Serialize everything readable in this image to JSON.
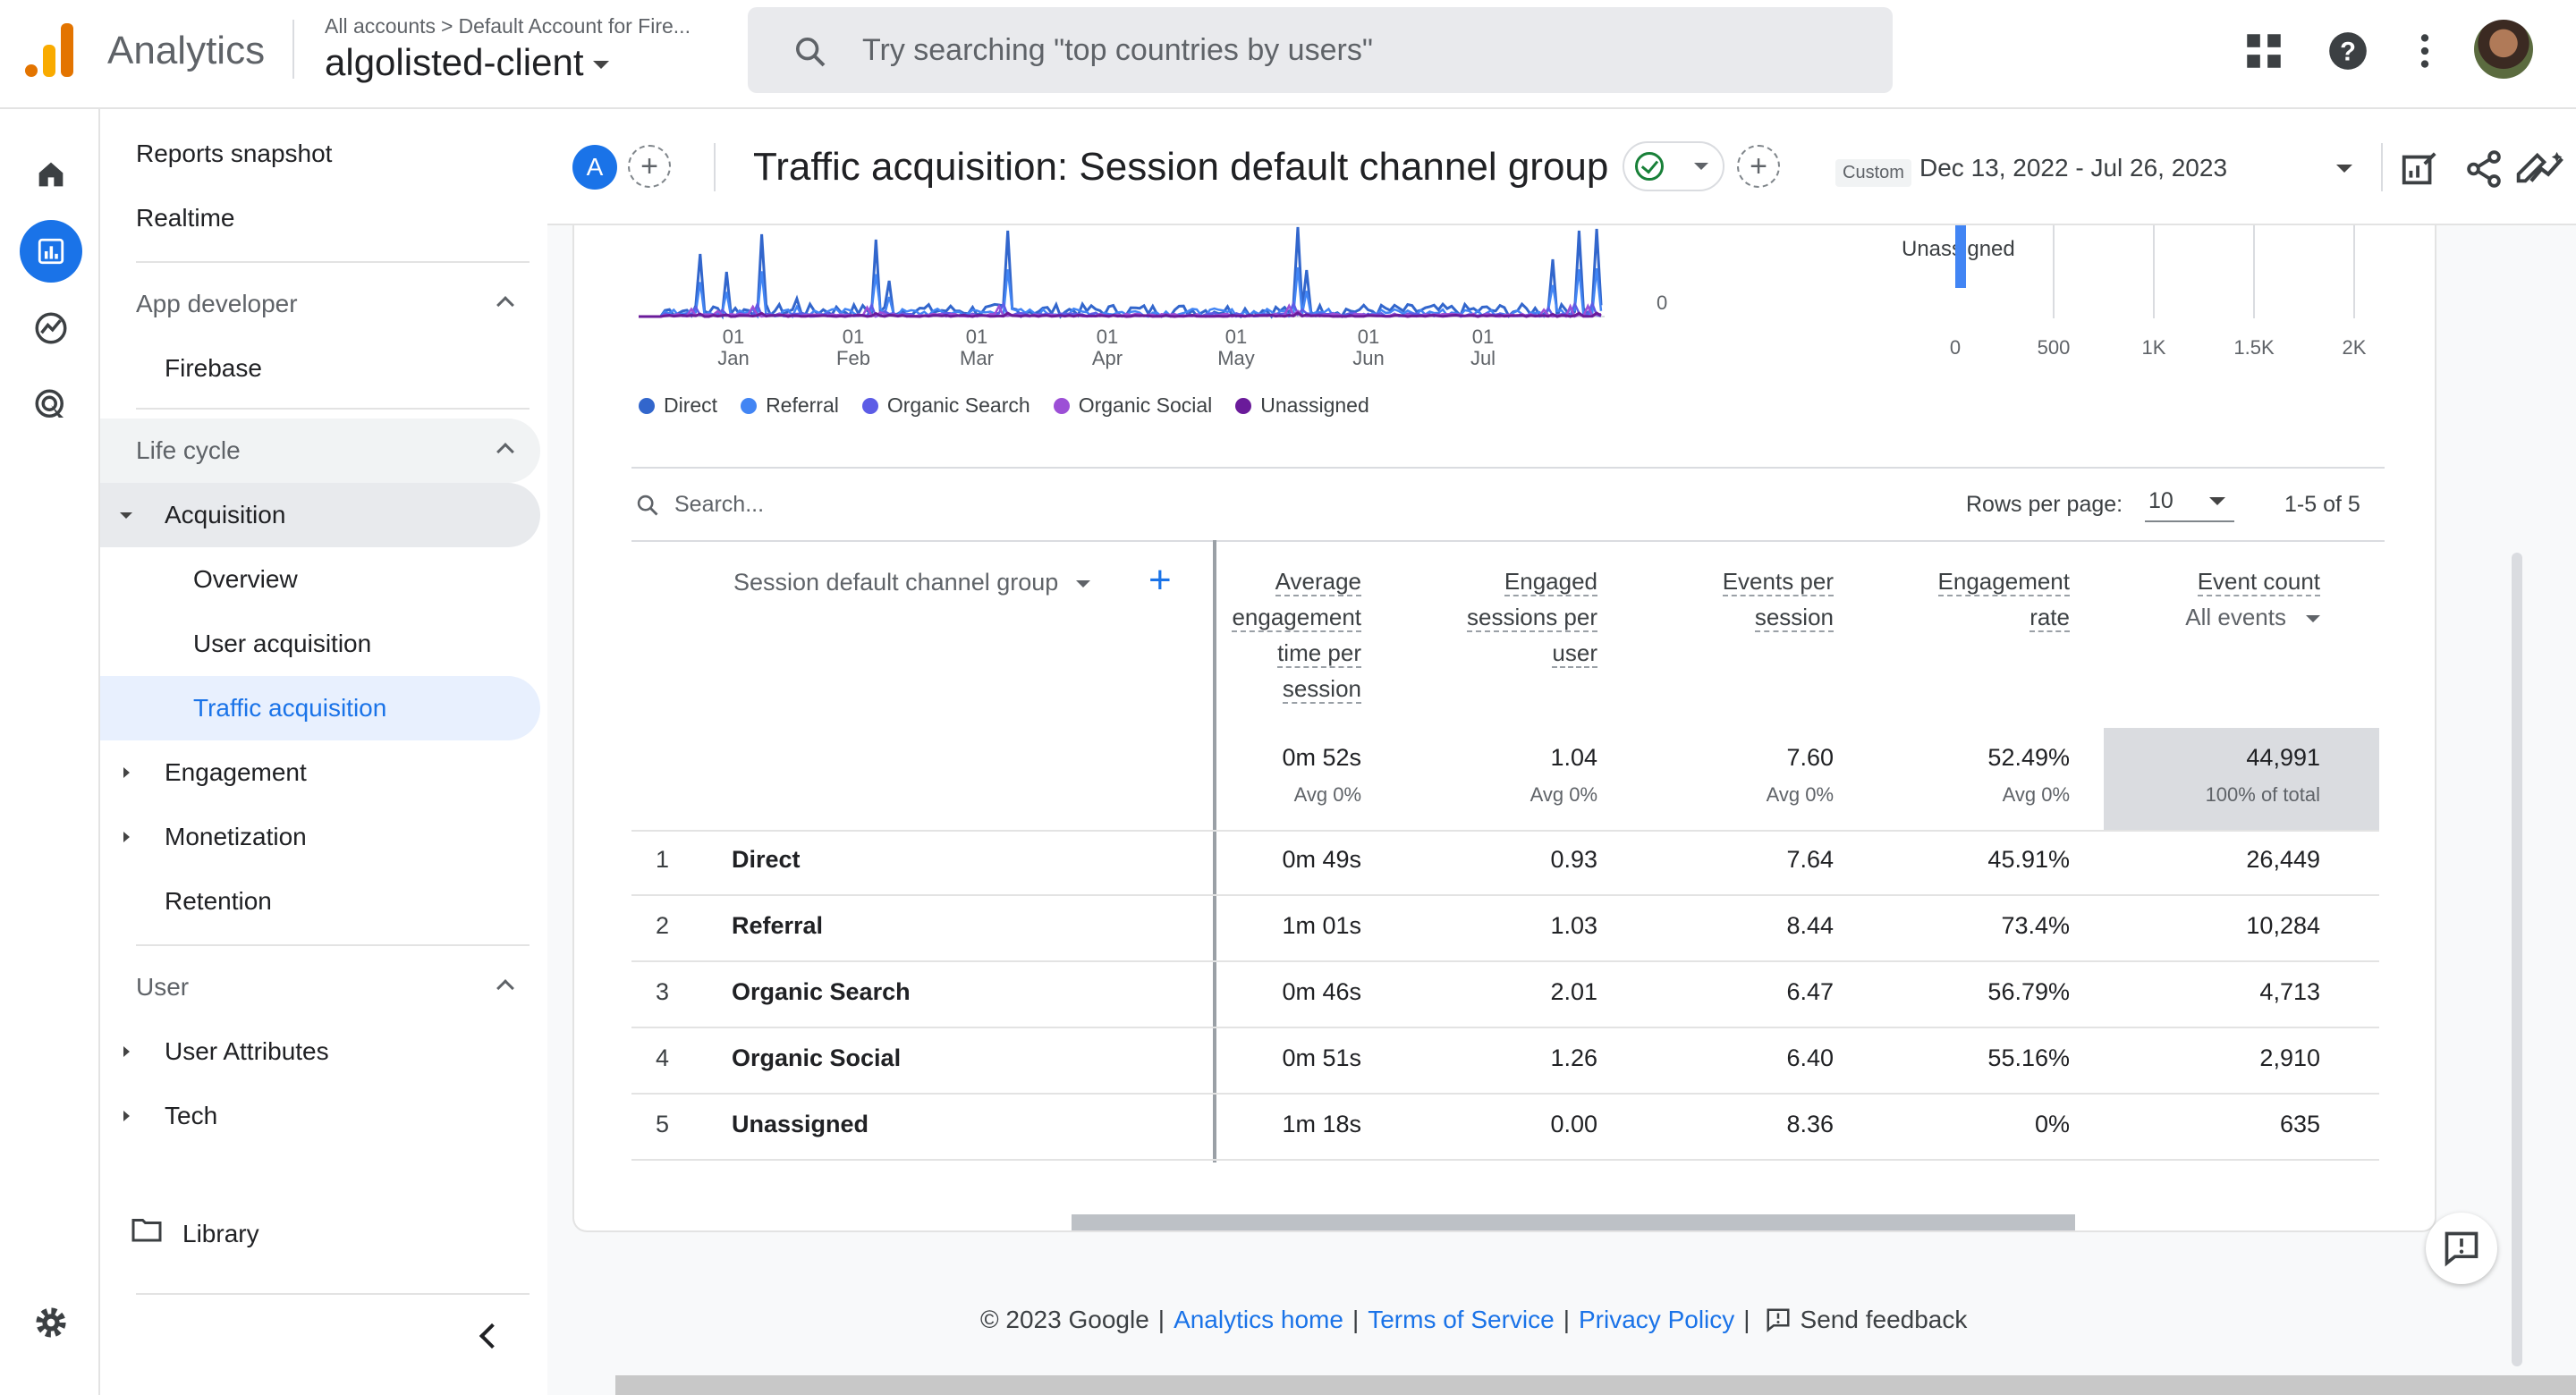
{
  "header": {
    "app_name": "Analytics",
    "breadcrumb": [
      "All accounts",
      "Default Account for Fire..."
    ],
    "breadcrumb_sep": ">",
    "property": "algolisted-client",
    "search_placeholder": "Try searching \"top countries by users\""
  },
  "rail": {
    "items": [
      "home-icon",
      "reports-icon",
      "explore-icon",
      "advertising-icon"
    ],
    "active": "reports-icon",
    "settings": "gear-icon"
  },
  "nav": {
    "reports_snapshot": "Reports snapshot",
    "realtime": "Realtime",
    "app_developer": "App developer",
    "firebase": "Firebase",
    "life_cycle": "Life cycle",
    "acquisition": "Acquisition",
    "overview": "Overview",
    "user_acquisition": "User acquisition",
    "traffic_acquisition": "Traffic acquisition",
    "engagement": "Engagement",
    "monetization": "Monetization",
    "retention": "Retention",
    "user": "User",
    "user_attributes": "User Attributes",
    "tech": "Tech",
    "library": "Library"
  },
  "report": {
    "comparison_badge": "A",
    "title": "Traffic acquisition: Session default channel group",
    "date_mode": "Custom",
    "date_range": "Dec 13, 2022 - Jul 26, 2023"
  },
  "colors": {
    "accent": "#1a73e8",
    "direct": "#3266cc",
    "referral": "#4285f4",
    "organic_search": "#5c5ce6",
    "organic_social": "#9c4fd6",
    "unassigned": "#6a1b9a",
    "active_nav_bg": "#e8f0fe"
  },
  "chart_data": [
    {
      "type": "line",
      "x_ticks": [
        [
          "01",
          "Jan"
        ],
        [
          "01",
          "Feb"
        ],
        [
          "01",
          "Mar"
        ],
        [
          "01",
          "Apr"
        ],
        [
          "01",
          "May"
        ],
        [
          "01",
          "Jun"
        ],
        [
          "01",
          "Jul"
        ]
      ],
      "y_ticks": [
        "0"
      ],
      "series": [
        {
          "name": "Direct",
          "shape": "spiky, peaks near early Jan, mid Jan, mid Feb, end Feb, mid May, late Jul"
        },
        {
          "name": "Referral"
        },
        {
          "name": "Organic Search"
        },
        {
          "name": "Organic Social"
        },
        {
          "name": "Unassigned"
        }
      ]
    },
    {
      "type": "bar",
      "orientation": "horizontal",
      "categories": [
        "Unassigned"
      ],
      "values": [
        0
      ],
      "x_ticks": [
        "0",
        "500",
        "1K",
        "1.5K",
        "2K"
      ],
      "xlim": [
        0,
        2000
      ]
    }
  ],
  "legend": [
    {
      "label": "Direct",
      "color": "#3266cc"
    },
    {
      "label": "Referral",
      "color": "#4285f4"
    },
    {
      "label": "Organic Search",
      "color": "#5c5ce6"
    },
    {
      "label": "Organic Social",
      "color": "#9c4fd6"
    },
    {
      "label": "Unassigned",
      "color": "#6a1b9a"
    }
  ],
  "table": {
    "search_placeholder": "Search...",
    "rows_per_page_label": "Rows per page:",
    "rows_per_page": "10",
    "pager": "1-5 of 5",
    "dimension": "Session default channel group",
    "columns": [
      {
        "lines": [
          "Average",
          "engagement",
          "time per",
          "session"
        ]
      },
      {
        "lines": [
          "Engaged",
          "sessions per",
          "user"
        ]
      },
      {
        "lines": [
          "Events per",
          "session"
        ]
      },
      {
        "lines": [
          "Engagement",
          "rate"
        ]
      },
      {
        "lines": [
          "Event count"
        ],
        "sub": "All events"
      }
    ],
    "totals": [
      {
        "value": "0m 52s",
        "sub": "Avg 0%"
      },
      {
        "value": "1.04",
        "sub": "Avg 0%"
      },
      {
        "value": "7.60",
        "sub": "Avg 0%"
      },
      {
        "value": "52.49%",
        "sub": "Avg 0%"
      },
      {
        "value": "44,991",
        "sub": "100% of total"
      }
    ],
    "rows": [
      {
        "idx": "1",
        "name": "Direct",
        "cells": [
          "0m 49s",
          "0.93",
          "7.64",
          "45.91%",
          "26,449"
        ]
      },
      {
        "idx": "2",
        "name": "Referral",
        "cells": [
          "1m 01s",
          "1.03",
          "8.44",
          "73.4%",
          "10,284"
        ]
      },
      {
        "idx": "3",
        "name": "Organic Search",
        "cells": [
          "0m 46s",
          "2.01",
          "6.47",
          "56.79%",
          "4,713"
        ]
      },
      {
        "idx": "4",
        "name": "Organic Social",
        "cells": [
          "0m 51s",
          "1.26",
          "6.40",
          "55.16%",
          "2,910"
        ]
      },
      {
        "idx": "5",
        "name": "Unassigned",
        "cells": [
          "1m 18s",
          "0.00",
          "8.36",
          "0%",
          "635"
        ]
      }
    ]
  },
  "footer": {
    "copyright": "© 2023 Google",
    "sep": "|",
    "analytics_home": "Analytics home",
    "terms": "Terms of Service",
    "privacy": "Privacy Policy",
    "send_feedback": "Send feedback"
  }
}
